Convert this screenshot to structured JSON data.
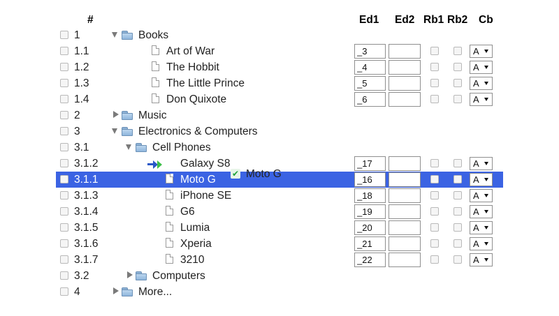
{
  "columns": {
    "num": "#",
    "ed1": "Ed1",
    "ed2": "Ed2",
    "rb1": "Rb1",
    "rb2": "Rb2",
    "cb": "Cb"
  },
  "colors": {
    "selection": "#3b63e3",
    "drop_arrow": "#2a58c8",
    "drop_arrow_accent": "#3fbf4a",
    "ghost_check": "#22a33a"
  },
  "rows": [
    {
      "num": "1",
      "title": "Books",
      "level": 0,
      "kind": "folder",
      "expander": "open"
    },
    {
      "num": "1.1",
      "title": "Art of War",
      "level": 1,
      "kind": "document",
      "ed1": "_3",
      "ed2": "",
      "cb": "A"
    },
    {
      "num": "1.2",
      "title": "The Hobbit",
      "level": 1,
      "kind": "document",
      "ed1": "_4",
      "ed2": "",
      "cb": "A"
    },
    {
      "num": "1.3",
      "title": "The Little Prince",
      "level": 1,
      "kind": "document",
      "ed1": "_5",
      "ed2": "",
      "cb": "A"
    },
    {
      "num": "1.4",
      "title": "Don Quixote",
      "level": 1,
      "kind": "document",
      "ed1": "_6",
      "ed2": "",
      "cb": "A"
    },
    {
      "num": "2",
      "title": "Music",
      "level": 0,
      "kind": "folder",
      "expander": "closed"
    },
    {
      "num": "3",
      "title": "Electronics & Computers",
      "level": 0,
      "kind": "folder",
      "expander": "open"
    },
    {
      "num": "3.1",
      "title": "Cell Phones",
      "level": 1,
      "kind": "folder",
      "expander": "open"
    },
    {
      "num": "3.1.2",
      "title": "Galaxy S8",
      "level": 2,
      "kind": "drop-target",
      "ed1": "_17",
      "ed2": "",
      "cb": "A"
    },
    {
      "num": "3.1.1",
      "title": "Moto G",
      "level": 2,
      "kind": "document",
      "ed1": "_16",
      "ed2": "",
      "cb": "A",
      "selected": true
    },
    {
      "num": "3.1.3",
      "title": "iPhone SE",
      "level": 2,
      "kind": "document",
      "ed1": "_18",
      "ed2": "",
      "cb": "A"
    },
    {
      "num": "3.1.4",
      "title": "G6",
      "level": 2,
      "kind": "document",
      "ed1": "_19",
      "ed2": "",
      "cb": "A"
    },
    {
      "num": "3.1.5",
      "title": "Lumia",
      "level": 2,
      "kind": "document",
      "ed1": "_20",
      "ed2": "",
      "cb": "A"
    },
    {
      "num": "3.1.6",
      "title": "Xperia",
      "level": 2,
      "kind": "document",
      "ed1": "_21",
      "ed2": "",
      "cb": "A"
    },
    {
      "num": "3.1.7",
      "title": "3210",
      "level": 2,
      "kind": "document",
      "ed1": "_22",
      "ed2": "",
      "cb": "A"
    },
    {
      "num": "3.2",
      "title": "Computers",
      "level": 1,
      "kind": "folder",
      "expander": "closed"
    },
    {
      "num": "4",
      "title": "More...",
      "level": 0,
      "kind": "folder",
      "expander": "closed"
    }
  ],
  "drag": {
    "ghost_label": "Moto G",
    "ghost_icon": "checkmark-icon"
  }
}
